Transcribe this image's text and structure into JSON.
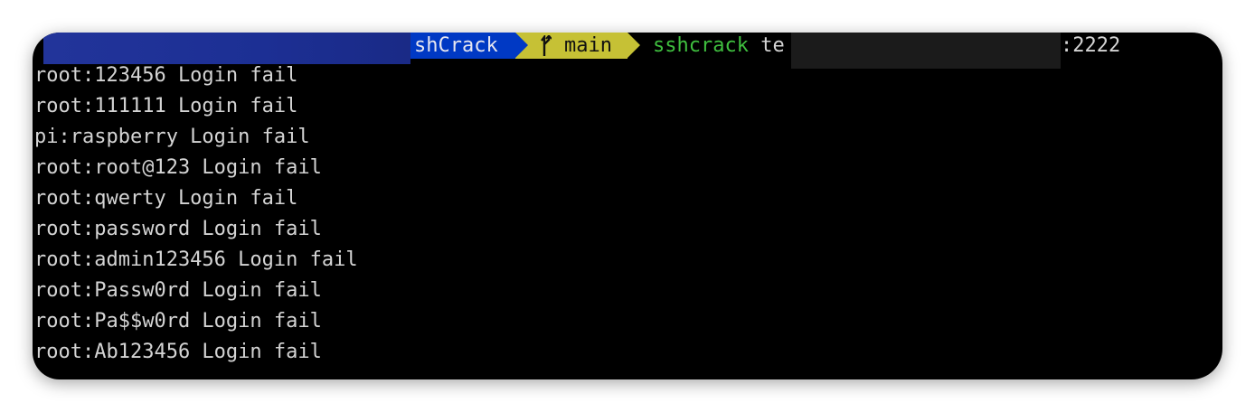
{
  "prompt": {
    "directory": "shCrack",
    "branch_icon": "git-branch-icon",
    "branch": "main",
    "command": "sshcrack",
    "arg_prefix": " te",
    "port": ":2222"
  },
  "output": [
    "root:123456 Login fail",
    "root:111111 Login fail",
    "pi:raspberry Login fail",
    "root:root@123 Login fail",
    "root:qwerty Login fail",
    "root:password Login fail",
    "root:admin123456 Login fail",
    "root:Passw0rd Login fail",
    "root:Pa$$w0rd Login fail",
    "root:Ab123456 Login fail"
  ],
  "colors": {
    "background": "#000000",
    "dir_segment": "#0039c4",
    "git_segment": "#c6c135",
    "command": "#3fbf3f",
    "text": "#d4d4d4"
  }
}
